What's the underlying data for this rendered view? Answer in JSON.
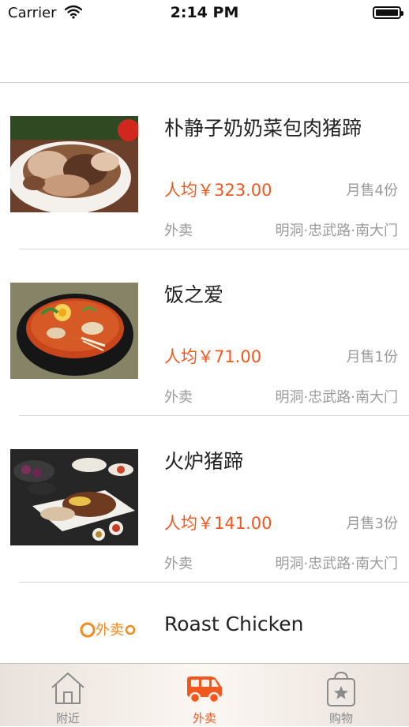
{
  "status_bar": {
    "carrier": "Carrier",
    "time": "2:14 PM"
  },
  "restaurants": [
    {
      "name": "朴静子奶奶菜包肉猪蹄",
      "price": "人均￥323.00",
      "sales": "月售4份",
      "type": "外卖",
      "address": "明洞·忠武路·南大门",
      "thumb_icon": "pork-feet-dish-photo"
    },
    {
      "name": "饭之爱",
      "price": "人均￥71.00",
      "sales": "月售1份",
      "type": "外卖",
      "address": "明洞·忠武路·南大门",
      "thumb_icon": "stew-bowl-photo"
    },
    {
      "name": "火炉猪蹄",
      "price": "人均￥141.00",
      "sales": "月售3份",
      "type": "外卖",
      "address": "明洞·忠武路·南大门",
      "thumb_icon": "bbq-platter-photo"
    },
    {
      "name": "Roast Chicken",
      "thumb_icon": "roast-chicken-photo",
      "badge": "外卖"
    }
  ],
  "tabs": [
    {
      "label": "附近",
      "icon": "house-icon",
      "active": false
    },
    {
      "label": "外卖",
      "icon": "delivery-van-icon",
      "active": true
    },
    {
      "label": "购物",
      "icon": "shopping-bag-star-icon",
      "active": false
    }
  ],
  "colors": {
    "accent": "#f2571e",
    "muted_text": "#9a9a9a",
    "separator": "#d8d8d8"
  }
}
